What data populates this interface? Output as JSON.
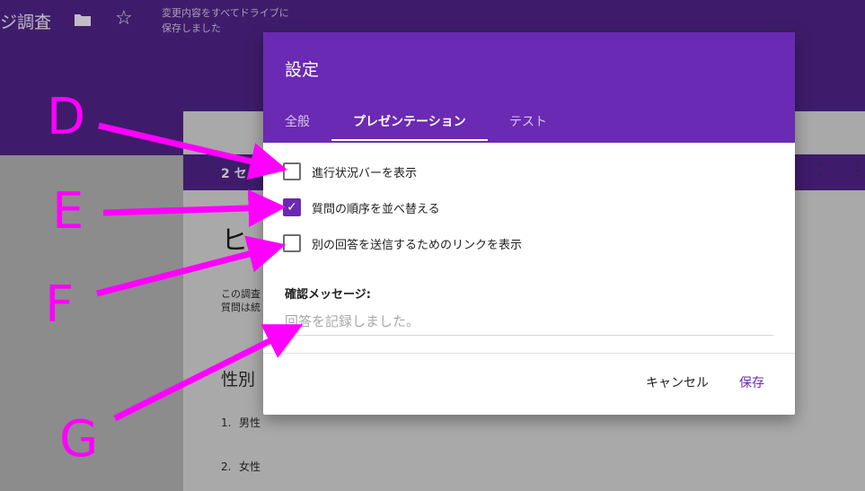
{
  "app": {
    "title": "ジ調査",
    "autosave_status": "変更内容をすべてドライブに\n保存しました",
    "section_label": "2 セ",
    "form_heading": "ヒ",
    "description": "この調査\n質問は統",
    "question_title": "性別",
    "options": [
      {
        "num": "1.",
        "label": "男性"
      },
      {
        "num": "2.",
        "label": "女性"
      }
    ]
  },
  "dialog": {
    "title": "設定",
    "tabs": [
      {
        "label": "全般",
        "active": false
      },
      {
        "label": "プレゼンテーション",
        "active": true
      },
      {
        "label": "テスト",
        "active": false
      }
    ],
    "options": [
      {
        "label": "進行状況バーを表示",
        "checked": false
      },
      {
        "label": "質問の順序を並べ替える",
        "checked": true
      },
      {
        "label": "別の回答を送信するためのリンクを表示",
        "checked": false
      }
    ],
    "confirmation_label": "確認メッセージ:",
    "confirmation_placeholder": "回答を記録しました。",
    "confirmation_value": "",
    "cancel_label": "キャンセル",
    "save_label": "保存"
  },
  "annotations": {
    "color": "#ff00ff",
    "labels": [
      "D",
      "E",
      "F",
      "G"
    ]
  },
  "colors": {
    "accent": "#6a2ab3",
    "header_dimmed": "#3e1c6b",
    "annotation": "#ff00ff"
  }
}
